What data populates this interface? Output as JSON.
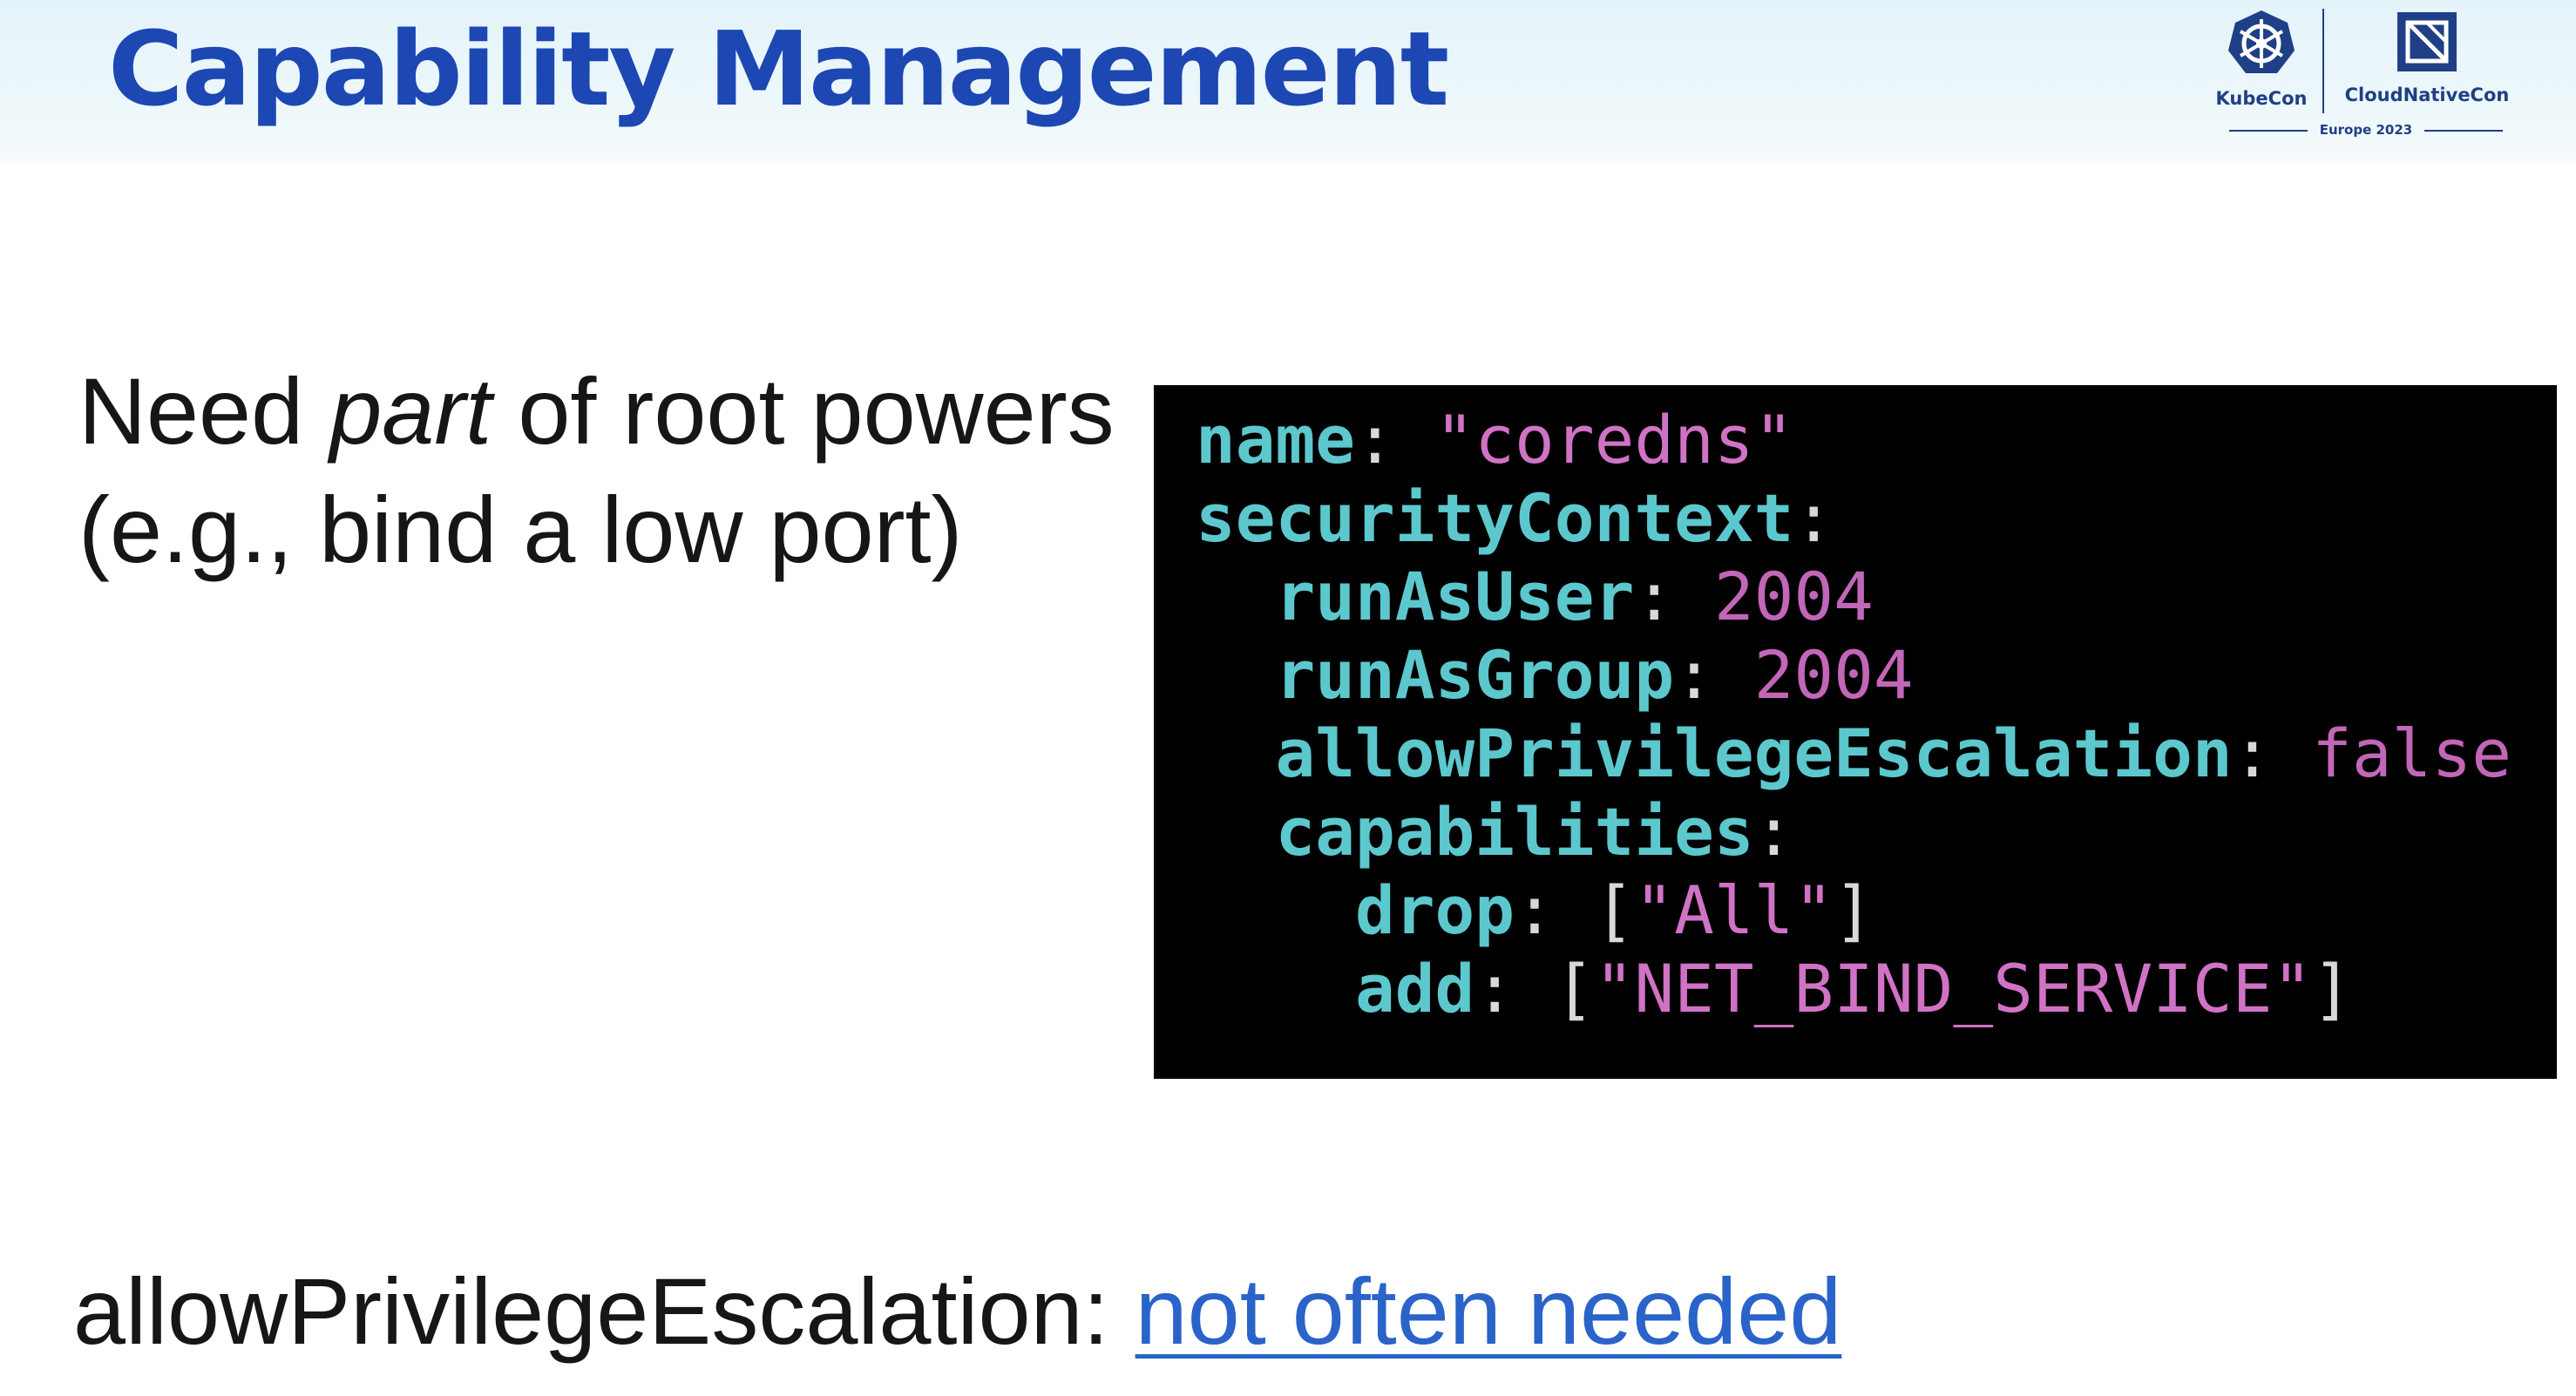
{
  "slide": {
    "title": "Capability Management"
  },
  "logos": {
    "kubecon_label": "KubeCon",
    "cloudnativecon_label": "CloudNativeCon",
    "event_label": "Europe 2023"
  },
  "lead": {
    "before_emphasis": "Need ",
    "emphasis": "part",
    "after_emphasis": " of root powers (e.g., bind a low port)"
  },
  "code": {
    "lines": [
      {
        "indent": "",
        "key": "name",
        "sep": ": ",
        "value": "\"coredns\"",
        "value_type": "string"
      },
      {
        "indent": "",
        "key": "securityContext",
        "sep": ":",
        "value": "",
        "value_type": "none"
      },
      {
        "indent": "  ",
        "key": "runAsUser",
        "sep": ": ",
        "value": "2004",
        "value_type": "number"
      },
      {
        "indent": "  ",
        "key": "runAsGroup",
        "sep": ": ",
        "value": "2004",
        "value_type": "number"
      },
      {
        "indent": "  ",
        "key": "allowPrivilegeEscalation",
        "sep": ": ",
        "value": "false",
        "value_type": "bool"
      },
      {
        "indent": "  ",
        "key": "capabilities",
        "sep": ":",
        "value": "",
        "value_type": "none"
      },
      {
        "indent": "    ",
        "key": "drop",
        "sep": ": ",
        "open": "[",
        "value": "\"All\"",
        "close": "]",
        "value_type": "list"
      },
      {
        "indent": "    ",
        "key": "add",
        "sep": ": ",
        "open": "[",
        "value": "\"NET_BIND_SERVICE\"",
        "close": "]",
        "value_type": "list"
      }
    ]
  },
  "footer": {
    "label": "allowPrivilegeEscalation: ",
    "link_text": "not often needed"
  },
  "colors": {
    "title_blue": "#1d47b3",
    "code_key": "#5cc8cd",
    "code_value": "#d072c5",
    "link": "#2a63c9"
  }
}
